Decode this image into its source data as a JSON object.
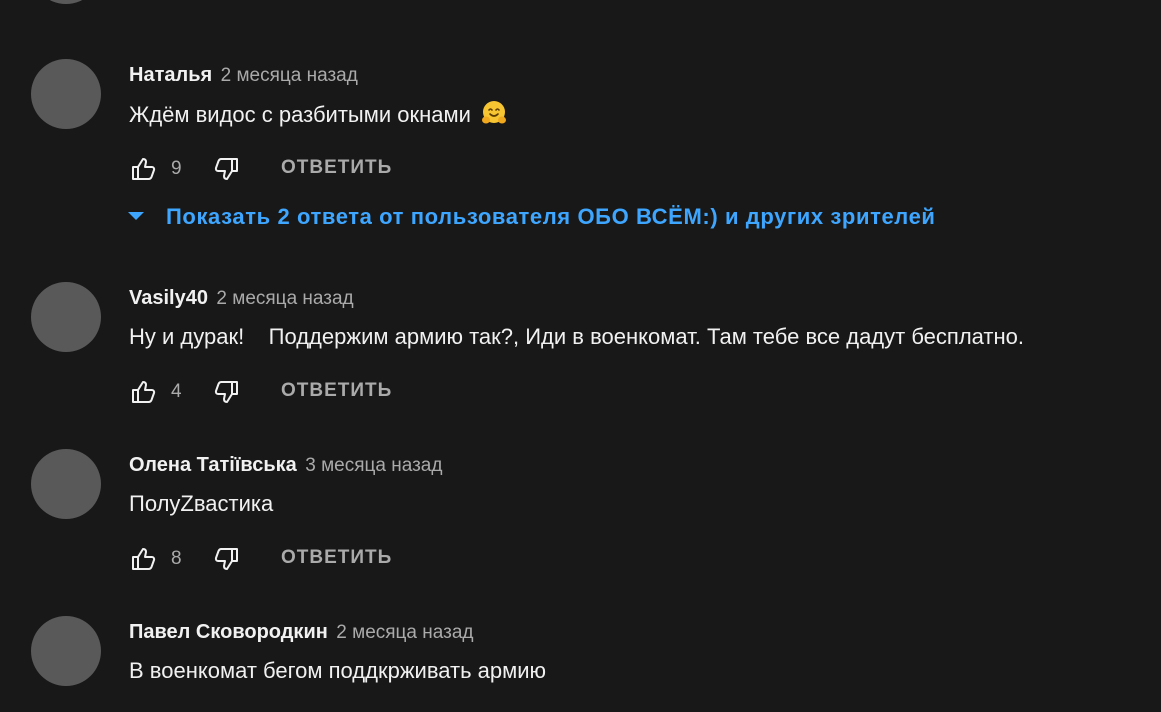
{
  "comments": [
    {
      "author": "Наталья",
      "time": "2 месяца назад",
      "text": "Ждём видос с разбитыми окнами",
      "emoji": "hugging-face",
      "likes": "9",
      "reply_label": "ОТВЕТИТЬ",
      "replies_label": "Показать 2 ответа от пользователя ОБО ВСЁМ:) и других зрителей"
    },
    {
      "author": "Vasily40",
      "time": "2 месяца назад",
      "text": "Ну и дурак!    Поддержим армию так?, Иди в военкомат. Там тебе все дадут бесплатно.",
      "likes": "4",
      "reply_label": "ОТВЕТИТЬ"
    },
    {
      "author": "Олена Татіївська",
      "time": "3 месяца назад",
      "text": "ПолуZвастика",
      "likes": "8",
      "reply_label": "ОТВЕТИТЬ"
    },
    {
      "author": "Павел Сковородкин",
      "time": "2 месяца назад",
      "text": "В военкомат бегом поддкрживать армию"
    }
  ],
  "colors": {
    "background": "#181818",
    "avatar": "#595959",
    "link": "#3ea6ff",
    "secondary_text": "#aaaaaa",
    "primary_text": "#f1f1f1"
  }
}
